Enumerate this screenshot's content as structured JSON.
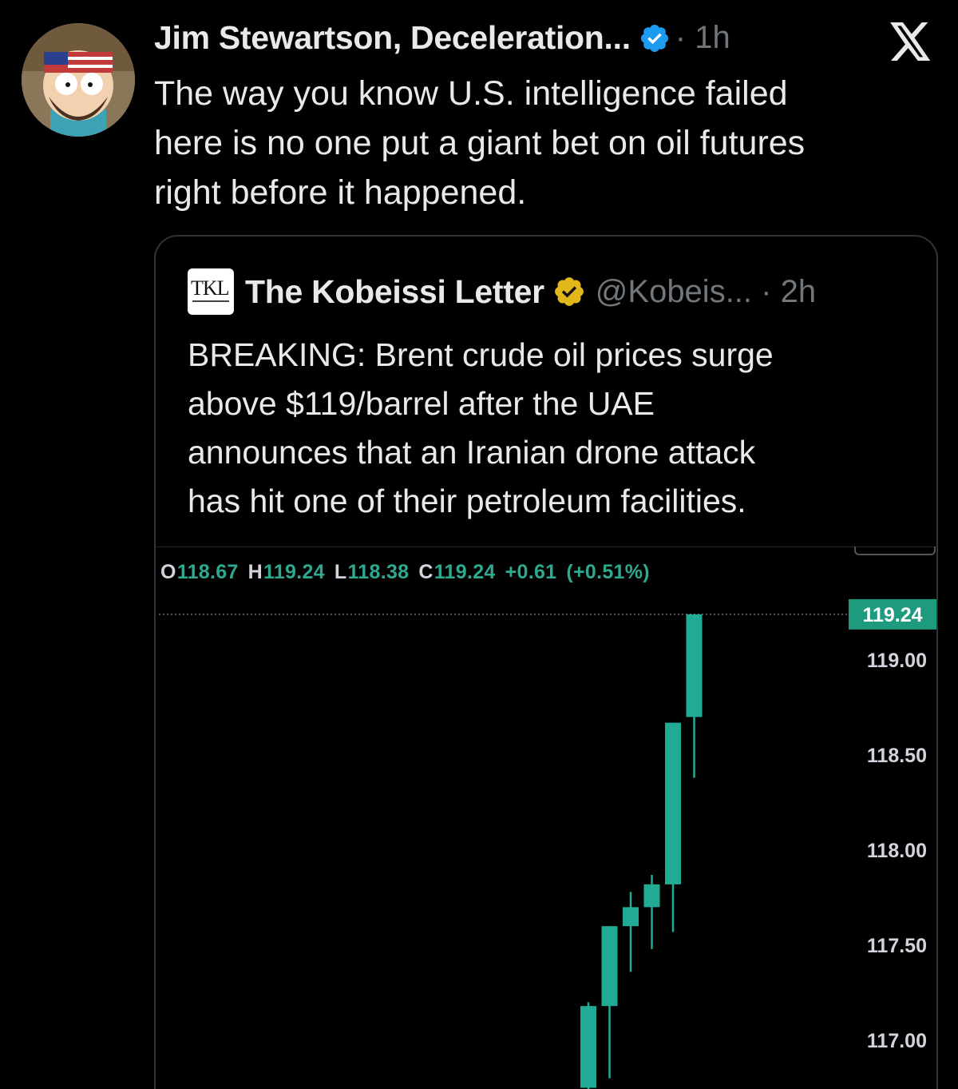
{
  "tweet": {
    "author_name": "Jim Stewartson, Deceleration...",
    "verified": true,
    "meta": "· 1h",
    "platform_icon": "x-logo-icon",
    "text_lines": [
      "The way you know U.S. intelligence failed",
      "here is no one put a giant bet on oil futures",
      "right before it happened."
    ]
  },
  "quote": {
    "logo_text": "TKL",
    "author_name": "The Kobeissi Letter",
    "verified_color": "gold",
    "meta": "@Kobeis... · 2h",
    "text_lines": [
      "BREAKING: Brent crude oil prices surge",
      "above $119/barrel after the UAE",
      "announces that an Iranian drone attack",
      "has hit one of their petroleum facilities."
    ]
  },
  "colors": {
    "background": "#000000",
    "text": "#e7e9ea",
    "muted": "#71767b",
    "verified_blue": "#1d9bf0",
    "verified_gold": "#e2b719",
    "candle_up": "#22ab94",
    "price_tag": "#1e9a7e"
  },
  "chart_data": {
    "type": "candlestick",
    "ohlc_legend": {
      "open_key": "O",
      "open": "118.67",
      "high_key": "H",
      "high": "119.24",
      "low_key": "L",
      "low": "118.38",
      "close_key": "C",
      "close": "119.24",
      "change": "+0.61",
      "change_pct": "(+0.51%)"
    },
    "last_price": "119.24",
    "y_ticks": [
      "119.00",
      "118.50",
      "118.00",
      "117.50",
      "117.00"
    ],
    "ylim": [
      116.75,
      119.35
    ],
    "candles": [
      {
        "open": 116.75,
        "high": 117.2,
        "low": 116.7,
        "close": 117.18
      },
      {
        "open": 117.18,
        "high": 117.6,
        "low": 116.8,
        "close": 117.6
      },
      {
        "open": 117.6,
        "high": 117.78,
        "low": 117.36,
        "close": 117.7
      },
      {
        "open": 117.7,
        "high": 117.87,
        "low": 117.48,
        "close": 117.82
      },
      {
        "open": 117.82,
        "high": 118.67,
        "low": 117.57,
        "close": 118.67
      },
      {
        "open": 118.7,
        "high": 119.24,
        "low": 118.38,
        "close": 119.24
      }
    ]
  }
}
